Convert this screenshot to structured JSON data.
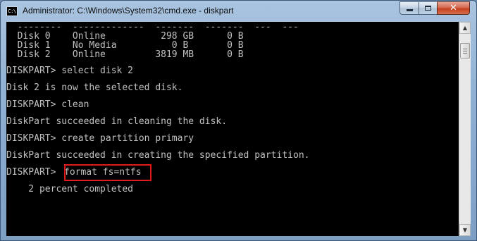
{
  "window": {
    "title": "Administrator: C:\\Windows\\System32\\cmd.exe - diskpart",
    "app_icon_text": "C:\\",
    "icon_names": {
      "app": "cmd-icon",
      "minimize": "minimize-icon",
      "maximize": "maximize-icon",
      "close": "close-icon",
      "scroll_up": "scroll-up-arrow-icon",
      "scroll_down": "scroll-down-arrow-icon"
    },
    "close_glyph": "✕",
    "scroll_up_glyph": "▲",
    "scroll_down_glyph": "▼"
  },
  "console": {
    "colors": {
      "background": "#000000",
      "text": "#c0c0c0",
      "highlight_border": "#e01a1a"
    },
    "separator_line": "  --------  -------------  -------  -------  ---  ---",
    "disks": [
      "  Disk 0    Online          298 GB      0 B",
      "  Disk 1    No Media          0 B       0 B",
      "  Disk 2    Online         3819 MB      0 B"
    ],
    "lines": [
      "DISKPART> select disk 2",
      "Disk 2 is now the selected disk.",
      "DISKPART> clean",
      "DiskPart succeeded in cleaning the disk.",
      "DISKPART> create partition primary",
      "DiskPart succeeded in creating the specified partition."
    ],
    "last_prompt": "DISKPART> ",
    "highlighted_command": "format fs=ntfs",
    "progress_line": "    2 percent completed",
    "progress_percent": 2
  }
}
